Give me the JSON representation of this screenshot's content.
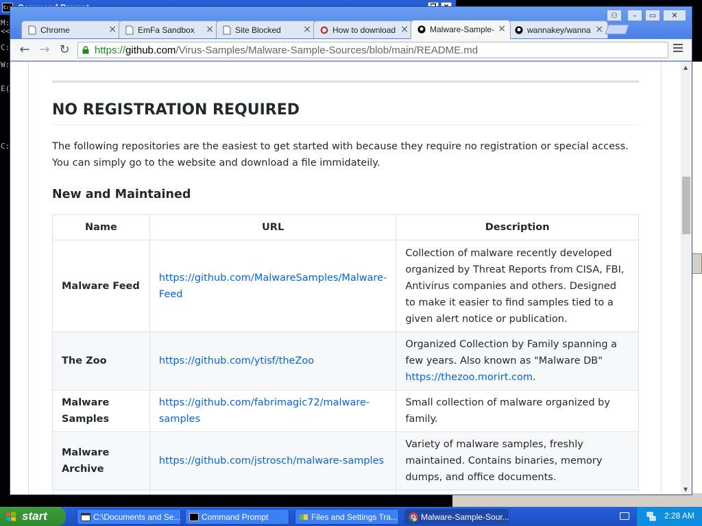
{
  "cmd": {
    "title": "Command Prompt",
    "icon": "C:\\",
    "lines": [
      "M:",
      "<<",
      "C:",
      "W:",
      "",
      "E(",
      "",
      "",
      "C:"
    ]
  },
  "browser": {
    "window_buttons": [
      "user-icon",
      "minimize-icon",
      "maximize-icon",
      "close-icon"
    ],
    "tabs": [
      {
        "label": "Chrome",
        "icon": "page-icon"
      },
      {
        "label": "EmFa Sandbox",
        "icon": "page-icon"
      },
      {
        "label": "Site Blocked",
        "icon": "page-icon"
      },
      {
        "label": "How to download",
        "icon": "quora-icon"
      },
      {
        "label": "Malware-Sample-S",
        "icon": "github-icon",
        "active": true
      },
      {
        "label": "wannakey/wanna",
        "icon": "github-icon"
      }
    ],
    "url": {
      "scheme": "https://",
      "host": "github.com",
      "path": "/Virus-Samples/Malware-Sample-Sources/blob/main/README.md"
    }
  },
  "content": {
    "heading": "NO REGISTRATION REQUIRED",
    "intro": "The following repositories are the easiest to get started with because they require no registration or special access. You can simply go to the website and download a file immidateily.",
    "subheading": "New and Maintained",
    "table": {
      "headers": [
        "Name",
        "URL",
        "Description"
      ],
      "rows": [
        {
          "name": "Malware Feed",
          "url": "https://github.com/MalwareSamples/Malware-Feed",
          "description": "Collection of malware recently developed organized by Threat Reports from CISA, FBI, Antivirus companies and others. Designed to make it easier to find samples tied to a given alert notice or publication.",
          "desc_link": ""
        },
        {
          "name": "The Zoo",
          "url": "https://github.com/ytisf/theZoo",
          "description": "Organized Collection by Family spanning a few years. Also known as \"Malware DB\"",
          "desc_link": "https://thezoo.morirt.com",
          "desc_suffix": "."
        },
        {
          "name": "Malware Samples",
          "url": "https://github.com/fabrimagic72/malware-samples",
          "description": "Small collection of malware organized by family.",
          "desc_link": ""
        },
        {
          "name": "Malware Archive",
          "url": "https://github.com/jstrosch/malware-samples",
          "description": "Variety of malware samples, freshly maintained. Contains binaries, memory dumps, and office documents.",
          "desc_link": ""
        }
      ]
    }
  },
  "taskbar": {
    "start_label": "start",
    "tasks": [
      {
        "label": "C:\\Documents and Se...",
        "icon": "explorer-window-icon"
      },
      {
        "label": "Command Prompt",
        "icon": "cmd-icon"
      },
      {
        "label": "Files and Settings Tra...",
        "icon": "transfer-wizard-icon"
      },
      {
        "label": "Malware-Sample-Sour...",
        "icon": "chrome-icon",
        "active": true
      }
    ],
    "clock": "2:28 AM"
  },
  "colors": {
    "link": "#0366d6",
    "url_secure": "#1a8f1a",
    "xp_blue": "#245ddb",
    "start_green": "#3c9a3c"
  }
}
